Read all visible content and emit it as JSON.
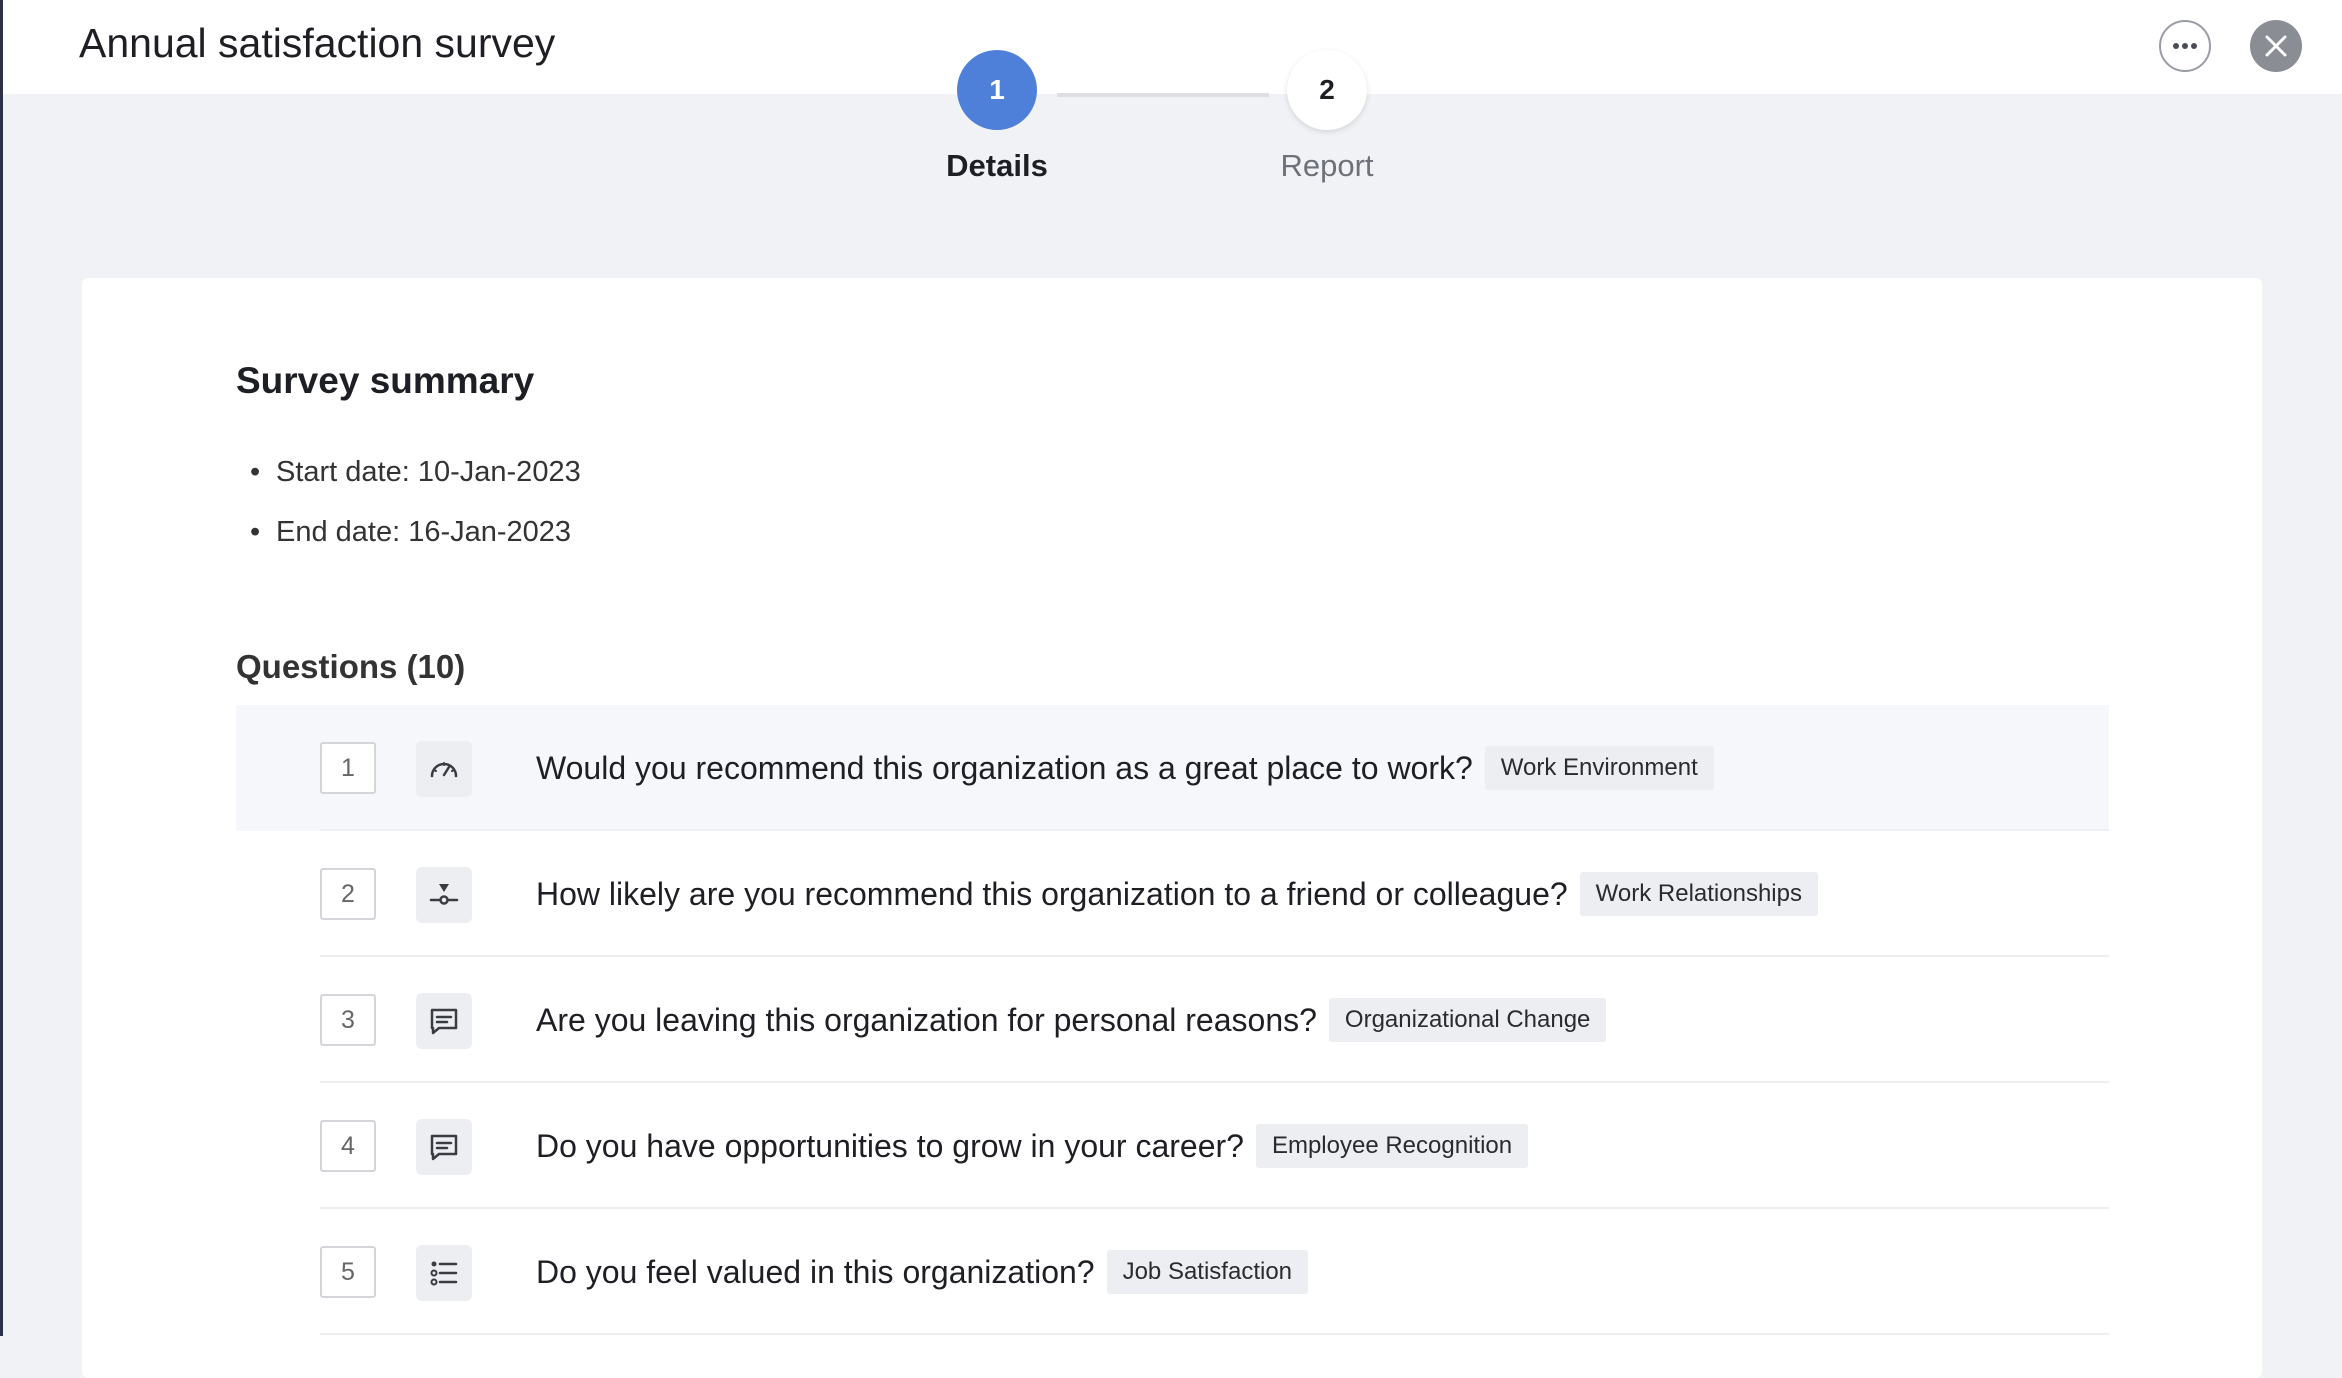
{
  "header": {
    "title": "Annual satisfaction survey",
    "more_icon": "more-horizontal-icon",
    "close_icon": "close-icon"
  },
  "stepper": {
    "steps": [
      {
        "number": "1",
        "label": "Details",
        "state": "active"
      },
      {
        "number": "2",
        "label": "Report",
        "state": "inactive"
      }
    ],
    "active_color": "#4f80d9"
  },
  "summary": {
    "title": "Survey summary",
    "start_date": "Start date: 10-Jan-2023",
    "end_date": "End date: 16-Jan-2023"
  },
  "questions": {
    "title": "Questions (10)",
    "items": [
      {
        "number": "1",
        "icon": "gauge-icon",
        "text": "Would you recommend this organization as a great place to work?",
        "tag": "Work Environment"
      },
      {
        "number": "2",
        "icon": "slider-icon",
        "text": "How likely are you recommend this organization to a friend or colleague?",
        "tag": "Work Relationships"
      },
      {
        "number": "3",
        "icon": "comment-icon",
        "text": "Are you leaving this organization for personal reasons?",
        "tag": "Organizational Change"
      },
      {
        "number": "4",
        "icon": "comment-icon",
        "text": "Do you have opportunities to grow in your career?",
        "tag": "Employee Recognition"
      },
      {
        "number": "5",
        "icon": "list-icon",
        "text": "Do you feel valued in this organization?",
        "tag": "Job Satisfaction"
      }
    ]
  }
}
